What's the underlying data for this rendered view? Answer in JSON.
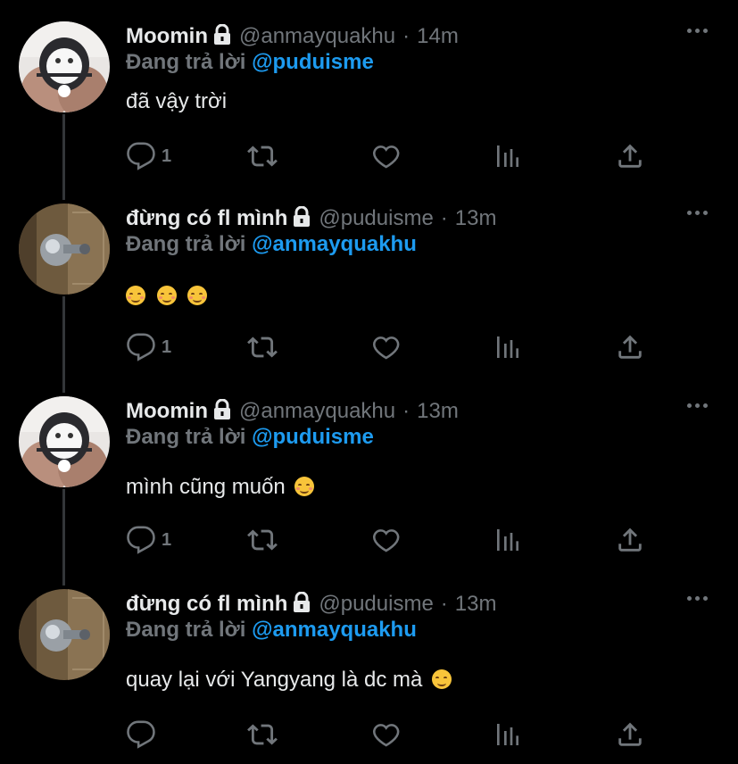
{
  "colors": {
    "background": "#000000",
    "secondary_text": "#71767b",
    "link": "#1d9bf0",
    "thread_line": "#333639"
  },
  "tweets": [
    {
      "name": "Moomin",
      "handle": "@anmayquakhu",
      "separator": "·",
      "time": "14m",
      "replying_prefix": "Đang trả lời",
      "replying_to": "@puduisme",
      "text": "đã vậy trời",
      "reply_count": "1",
      "avatar": "moomin-plush-avatar"
    },
    {
      "name": "đừng có fl mình",
      "handle": "@puduisme",
      "separator": "·",
      "time": "13m",
      "replying_prefix": "Đang trả lời",
      "replying_to": "@anmayquakhu",
      "text": "",
      "emoji_after": [
        "smiling-blush-emoji",
        "smiling-blush-emoji",
        "smiling-blush-emoji"
      ],
      "reply_count": "1",
      "avatar": "doorknob-avatar"
    },
    {
      "name": "Moomin",
      "handle": "@anmayquakhu",
      "separator": "·",
      "time": "13m",
      "replying_prefix": "Đang trả lời",
      "replying_to": "@puduisme",
      "text": "mình cũng muốn",
      "emoji_after": [
        "smiling-blush-emoji"
      ],
      "reply_count": "1",
      "avatar": "moomin-plush-avatar"
    },
    {
      "name": "đừng có fl mình",
      "handle": "@puduisme",
      "separator": "·",
      "time": "13m",
      "replying_prefix": "Đang trả lời",
      "replying_to": "@anmayquakhu",
      "text": "quay lại với Yangyang là dc mà",
      "emoji_after": [
        "winking-face-emoji"
      ],
      "reply_count": "",
      "avatar": "doorknob-avatar"
    }
  ],
  "icons": {
    "reply": "reply-icon",
    "retweet": "retweet-icon",
    "like": "heart-icon",
    "analytics": "analytics-icon",
    "share": "share-icon",
    "more": "more-icon",
    "protected": "lock-icon"
  }
}
